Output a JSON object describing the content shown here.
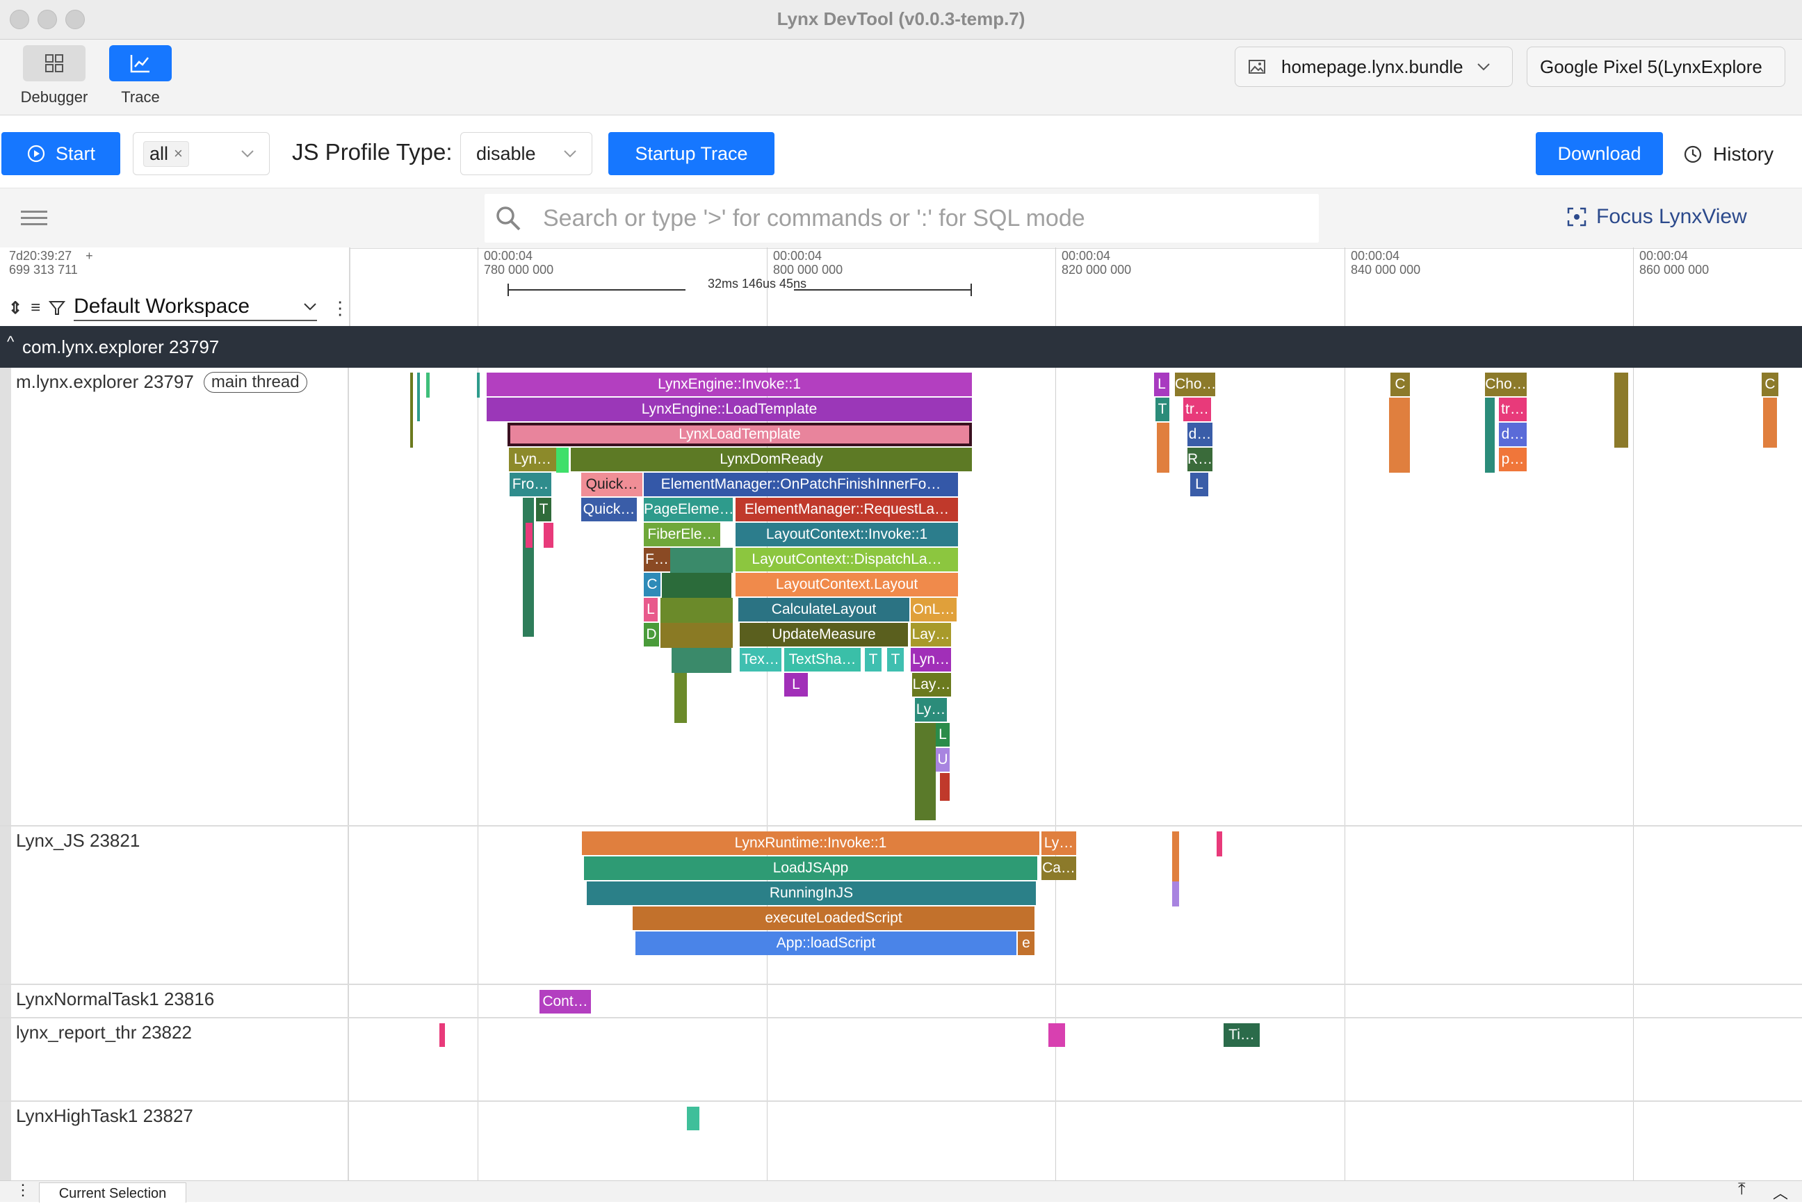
{
  "window": {
    "title": "Lynx DevTool (v0.0.3-temp.7)"
  },
  "toolbar": {
    "debugger_label": "Debugger",
    "trace_label": "Trace",
    "bundle": "homepage.lynx.bundle",
    "device": "Google Pixel 5(LynxExplore"
  },
  "controls": {
    "start_label": "Start",
    "category_tag": "all",
    "js_profile_label": "JS Profile Type:",
    "js_profile_value": "disable",
    "startup_trace_label": "Startup Trace",
    "download_label": "Download",
    "history_label": "History"
  },
  "search": {
    "placeholder": "Search or type '>' for commands or ':' for SQL mode",
    "focus_label": "Focus LynxView"
  },
  "timeline": {
    "origin_line1": "7d20:39:27",
    "origin_plus": "+",
    "origin_line2": "699 313 711",
    "workspace": "Default Workspace",
    "ticks": [
      {
        "t": "00:00:04",
        "n": "780 000 000"
      },
      {
        "t": "00:00:04",
        "n": "800 000 000"
      },
      {
        "t": "00:00:04",
        "n": "820 000 000"
      },
      {
        "t": "00:00:04",
        "n": "840 000 000"
      },
      {
        "t": "00:00:04",
        "n": "860 000 000"
      }
    ],
    "measure": "32ms 146us 45ns"
  },
  "process": {
    "name": "com.lynx.explorer 23797"
  },
  "tracks": {
    "main": {
      "name": "m.lynx.explorer 23797",
      "badge": "main thread"
    },
    "js": {
      "name": "Lynx_JS 23821"
    },
    "normal": {
      "name": "LynxNormalTask1 23816"
    },
    "report": {
      "name": "lynx_report_thr 23822"
    },
    "high": {
      "name": "LynxHighTask1 23827"
    }
  },
  "slices": {
    "main": [
      {
        "label": "LynxEngine::Invoke::1",
        "color": "#b33fc0"
      },
      {
        "label": "LynxEngine::LoadTemplate",
        "color": "#9b37b8"
      },
      {
        "label": "LynxLoadTemplate",
        "color": "#e8849c"
      },
      {
        "label": "LynxDomReady",
        "color": "#5d7a25"
      },
      {
        "label": "Lyn…",
        "color": "#8c8a2a"
      },
      {
        "label": "Fro…",
        "color": "#2f8c8c"
      },
      {
        "label": "Quick…",
        "color": "#f08e96"
      },
      {
        "label": "ElementManager::OnPatchFinishInnerFo…",
        "color": "#3458a8"
      },
      {
        "label": "T",
        "color": "#2f6b3a"
      },
      {
        "label": "Quick…",
        "color": "#3a5da8"
      },
      {
        "label": "PageEleme…",
        "color": "#2e9b8c"
      },
      {
        "label": "ElementManager::RequestLa…",
        "color": "#c0392b"
      },
      {
        "label": "FiberEle…",
        "color": "#6fa83a"
      },
      {
        "label": "LayoutContext::Invoke::1",
        "color": "#2c7d8c"
      },
      {
        "label": "F…",
        "color": "#8a4a24"
      },
      {
        "label": "LayoutContext::DispatchLa…",
        "color": "#8cc63f"
      },
      {
        "label": "C",
        "color": "#2e8bb8"
      },
      {
        "label": "LayoutContext.Layout",
        "color": "#f08a4b"
      },
      {
        "label": "L",
        "color": "#e85a8c"
      },
      {
        "label": "CalculateLayout",
        "color": "#2b7383"
      },
      {
        "label": "OnL…",
        "color": "#e0a03a"
      },
      {
        "label": "D",
        "color": "#4a9b3a"
      },
      {
        "label": "UpdateMeasure",
        "color": "#5a5f1e"
      },
      {
        "label": "Lay…",
        "color": "#a89a2a"
      },
      {
        "label": "Tex…",
        "color": "#3fbfb0"
      },
      {
        "label": "TextSha…",
        "color": "#3abfa8"
      },
      {
        "label": "T",
        "color": "#3fbfb0"
      },
      {
        "label": "T",
        "color": "#3fbfb0"
      },
      {
        "label": "Lyn…",
        "color": "#a12fb8"
      },
      {
        "label": "L",
        "color": "#a12fb8"
      },
      {
        "label": "Lay…",
        "color": "#6b7a1e"
      },
      {
        "label": "Ly…",
        "color": "#2b8c7a"
      },
      {
        "label": "L",
        "color": "#2a8c4a"
      },
      {
        "label": "U",
        "color": "#a884e0"
      },
      {
        "label": "L",
        "color": "#a83ac0"
      },
      {
        "label": "Cho…",
        "color": "#8c7a2a"
      },
      {
        "label": "T",
        "color": "#2b8c7a"
      },
      {
        "label": "tr…",
        "color": "#e83a7a"
      },
      {
        "label": "d…",
        "color": "#3a5da8"
      },
      {
        "label": "R…",
        "color": "#3a6b3a"
      },
      {
        "label": "L",
        "color": "#3a5da8"
      },
      {
        "label": "C",
        "color": "#8c7a2a"
      },
      {
        "label": "Cho…",
        "color": "#8c7a2a"
      },
      {
        "label": "tr…",
        "color": "#e83a7a"
      },
      {
        "label": "d…",
        "color": "#5a6bd8"
      },
      {
        "label": "p…",
        "color": "#f0763a"
      },
      {
        "label": "C",
        "color": "#8c7a2a"
      }
    ],
    "js": [
      {
        "label": "LynxRuntime::Invoke::1",
        "color": "#e07f3e"
      },
      {
        "label": "Ly…",
        "color": "#e07f3e"
      },
      {
        "label": "LoadJSApp",
        "color": "#2e9b74"
      },
      {
        "label": "Ca…",
        "color": "#8c7a2a"
      },
      {
        "label": "RunningInJS",
        "color": "#2b8088"
      },
      {
        "label": "executeLoadedScript",
        "color": "#c2712c"
      },
      {
        "label": "App::loadScript",
        "color": "#4a84e8"
      },
      {
        "label": "e",
        "color": "#c2712c"
      }
    ],
    "normal": [
      {
        "label": "Cont…",
        "color": "#b33fc0"
      }
    ],
    "report": [
      {
        "label": "Ti…",
        "color": "#2b6b4a"
      }
    ]
  },
  "bottom": {
    "tab": "Current Selection"
  }
}
